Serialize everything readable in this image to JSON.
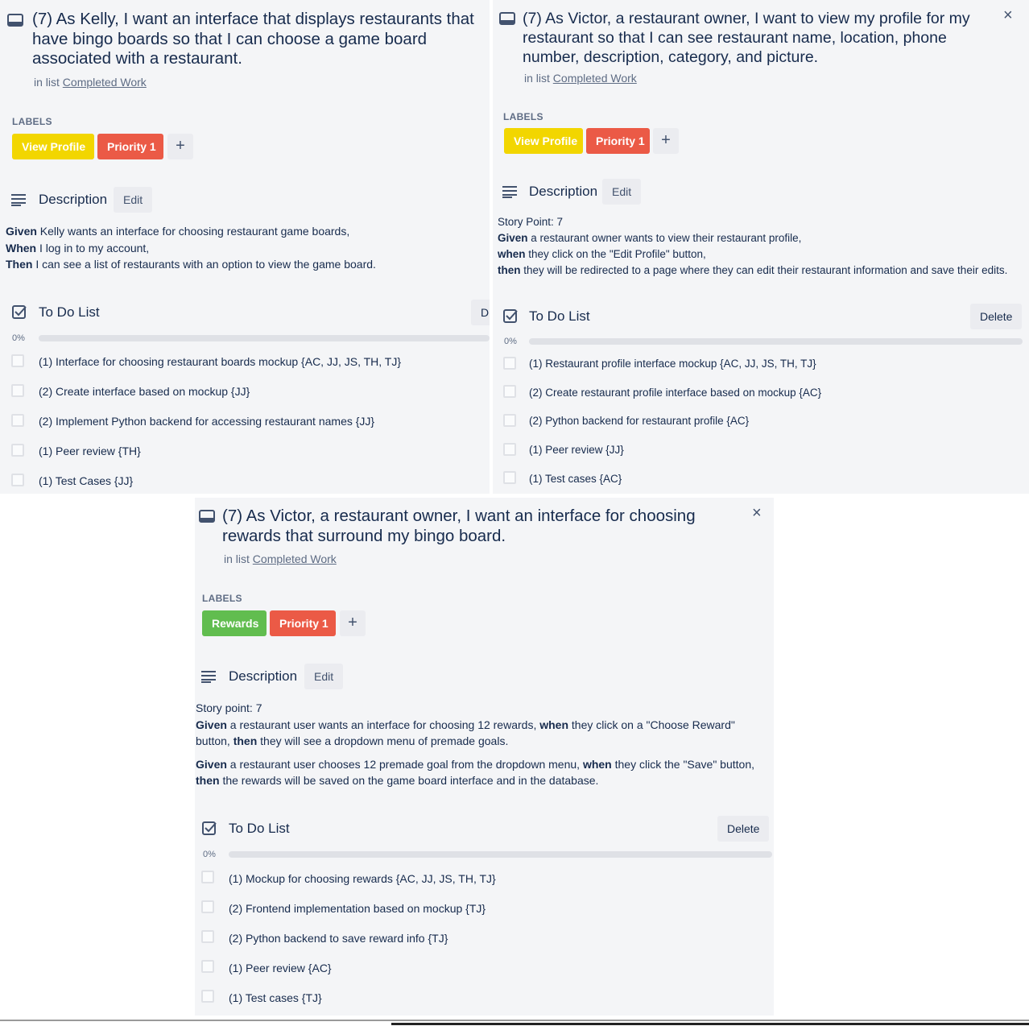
{
  "common": {
    "in_list_prefix": "in list",
    "list_name": "Completed Work",
    "labels_heading": "LABELS",
    "add_label": "+",
    "description_title": "Description",
    "edit_label": "Edit",
    "todo_title": "To Do List",
    "delete_label": "Delete",
    "delete_truncated": "D",
    "percent": "0%",
    "close": "×"
  },
  "card1": {
    "title": "(7) As Kelly, I want an interface that displays restaurants that have bingo boards so that I can choose a game board associated with a restaurant.",
    "labels": [
      "View Profile",
      "Priority 1"
    ],
    "description": [
      {
        "bold": "Given",
        "text": " Kelly wants an interface for choosing restaurant game boards,"
      },
      {
        "bold": "When",
        "text": " I log in to my account,"
      },
      {
        "bold": "Then",
        "text": " I can see a list of restaurants with an option to view the game board."
      }
    ],
    "items": [
      "(1) Interface for choosing restaurant boards mockup {AC, JJ, JS, TH, TJ}",
      "(2) Create interface based on mockup {JJ}",
      "(2) Implement Python backend for accessing restaurant names {JJ}",
      "(1) Peer review {TH}",
      "(1) Test Cases {JJ}"
    ]
  },
  "card2": {
    "title": "(7) As Victor, a restaurant owner, I want to view my profile for my restaurant so that I can see restaurant name, location, phone number, description, category, and picture.",
    "labels": [
      "View Profile",
      "Priority 1"
    ],
    "story_point": "Story Point: 7",
    "description": [
      {
        "bold": "Given",
        "text": " a restaurant owner wants to view their restaurant profile,"
      },
      {
        "bold": "when",
        "text": " they click on the \"Edit Profile\" button,"
      },
      {
        "bold": "then",
        "text": " they will be redirected to a page where they can edit their restaurant information and save their edits."
      }
    ],
    "items": [
      "(1) Restaurant profile interface mockup {AC, JJ, JS, TH, TJ}",
      "(2) Create restaurant profile interface based on mockup {AC}",
      "(2) Python backend for restaurant profile {AC}",
      "(1) Peer review {JJ}",
      "(1) Test cases {AC}"
    ]
  },
  "card3": {
    "title": "(7) As Victor, a restaurant owner, I want an interface for choosing rewards that surround my bingo board.",
    "labels": [
      "Rewards",
      "Priority 1"
    ],
    "story_point": "Story point: 7",
    "para1": {
      "b1": "Given",
      "t1": " a restaurant user wants an interface for choosing 12 rewards, ",
      "b2": "when",
      "t2": " they click on a \"Choose Reward\" button, ",
      "b3": "then",
      "t3": " they will see a dropdown menu of premade goals."
    },
    "para2": {
      "b1": "Given",
      "t1": " a restaurant user chooses 12 premade goal from the dropdown menu, ",
      "b2": "when",
      "t2": " they click the \"Save\" button, ",
      "b3": "then",
      "t3": " the rewards will be saved on the game board interface and in the database."
    },
    "items": [
      "(1) Mockup for choosing rewards {AC, JJ, JS, TH, TJ}",
      "(2) Frontend implementation based on mockup {TJ}",
      "(2) Python backend to save reward info {TJ}",
      "(1) Peer review {AC}",
      "(1) Test cases {TJ}"
    ]
  },
  "colors": {
    "card_bg": "#f4f5f7",
    "label_yellow": "#f2d600",
    "label_red": "#eb5a46",
    "label_green": "#61bd4f"
  }
}
